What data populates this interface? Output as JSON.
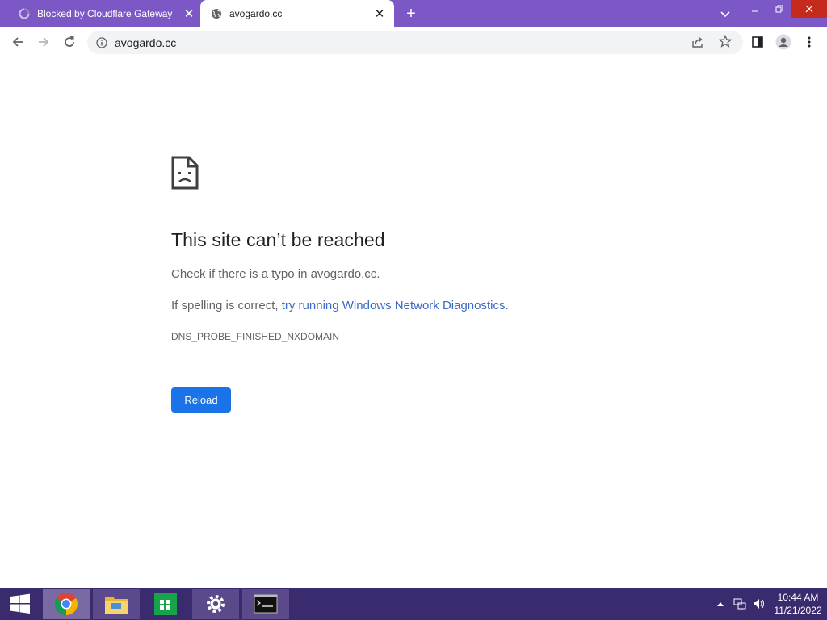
{
  "browser": {
    "tabs": [
      {
        "title": "Blocked by Cloudflare Gateway",
        "active": false,
        "favicon": "loading-spinner-icon"
      },
      {
        "title": "avogardo.cc",
        "active": true,
        "favicon": "globe-icon"
      }
    ],
    "new_tab": "+",
    "address": "avogardo.cc",
    "colors": {
      "tabstrip": "#7b58c6",
      "accent": "#1a73e8"
    }
  },
  "error_page": {
    "title": "This site can’t be reached",
    "line1": "Check if there is a typo in avogardo.cc.",
    "line2_prefix": "If spelling is correct, ",
    "line2_link1": "try running",
    "line2_space": " ",
    "line2_link2": "Windows Network Diagnostics",
    "line2_suffix": ".",
    "error_code": "DNS_PROBE_FINISHED_NXDOMAIN",
    "reload_label": "Reload"
  },
  "taskbar": {
    "apps": [
      "chrome-icon",
      "file-explorer-icon",
      "store-icon",
      "settings-icon",
      "terminal-icon"
    ],
    "time": "10:44 AM",
    "date": "11/21/2022"
  }
}
